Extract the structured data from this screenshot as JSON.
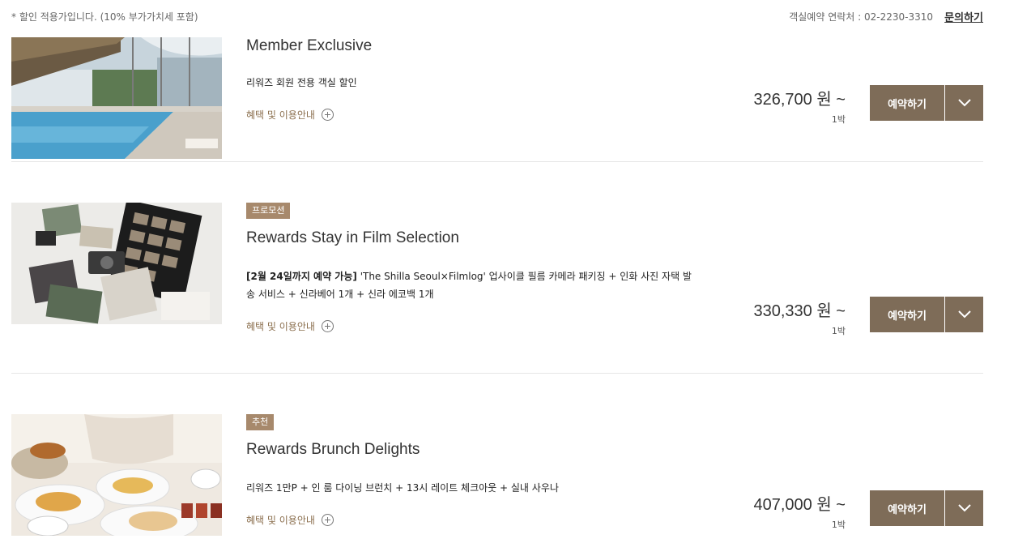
{
  "header": {
    "discount_note": "* 할인 적용가입니다. (10% 부가가치세 포함)",
    "contact": "객실예약 연락처 : 02-2230-3310",
    "inquiry_link": "문의하기"
  },
  "packages": [
    {
      "badge": "",
      "title": "Member Exclusive",
      "desc_bold": "",
      "description": "리워즈 회원 전용 객실 할인",
      "benefit_link": "혜택 및 이용안내",
      "price": "326,700 원 ~",
      "nights": "1박",
      "book_label": "예약하기",
      "image_icon": "pool-photo"
    },
    {
      "badge": "프로모션",
      "title": "Rewards Stay in Film Selection",
      "desc_bold": "[2월 24일까지 예약 가능]",
      "description": " 'The Shilla Seoul×Filmlog' 업사이클 필름 카메라 패키징 + 인화 사진 자택 발송 서비스 + 신라베어 1개 + 신라 에코백 1개",
      "benefit_link": "혜택 및 이용안내",
      "price": "330,330 원 ~",
      "nights": "1박",
      "book_label": "예약하기",
      "image_icon": "film-camera-photo"
    },
    {
      "badge": "추천",
      "title": "Rewards Brunch Delights",
      "desc_bold": "",
      "description": "리워즈 1만P + 인 룸 다이닝 브런치 + 13시 레이트 체크아웃 + 실내 사우나",
      "benefit_link": "혜택 및 이용안내",
      "price": "407,000 원 ~",
      "nights": "1박",
      "book_label": "예약하기",
      "image_icon": "brunch-photo"
    }
  ],
  "colors": {
    "accent": "#7e6c58",
    "badge": "#a7896c",
    "benefit_text": "#8b6f4e"
  }
}
